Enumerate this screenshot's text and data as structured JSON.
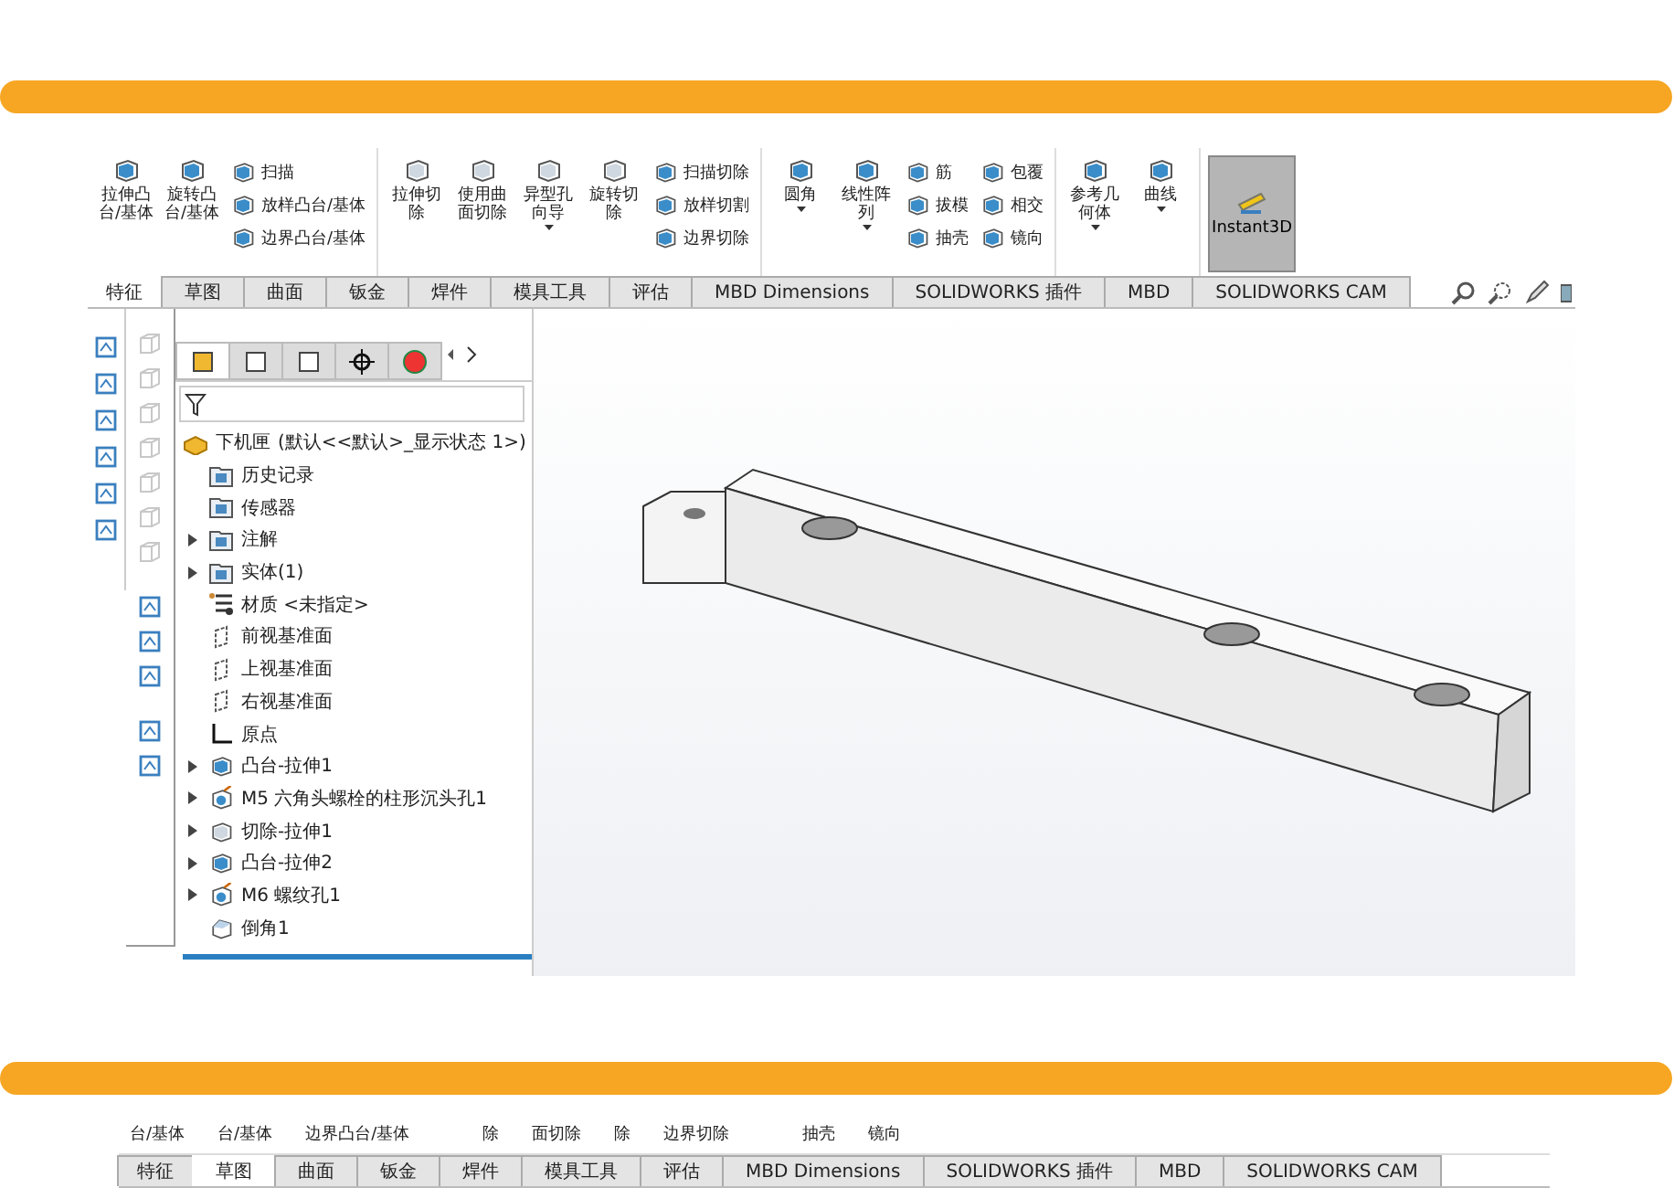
{
  "ribbon": {
    "groups": [
      {
        "big": [
          {
            "label": "拉伸凸台/基体",
            "dropdown": false
          },
          {
            "label": "旋转凸台/基体",
            "dropdown": false
          }
        ],
        "stacks": [
          [
            "扫描",
            "放样凸台/基体",
            "边界凸台/基体"
          ]
        ]
      },
      {
        "big": [
          {
            "label": "拉伸切除",
            "dropdown": false
          },
          {
            "label": "使用曲面切除",
            "dropdown": false
          },
          {
            "label": "异型孔向导",
            "dropdown": true
          },
          {
            "label": "旋转切除",
            "dropdown": false
          }
        ],
        "stacks": [
          [
            "扫描切除",
            "放样切割",
            "边界切除"
          ]
        ]
      },
      {
        "big": [
          {
            "label": "圆角",
            "dropdown": true
          },
          {
            "label": "线性阵列",
            "dropdown": true
          }
        ],
        "stacks": [
          [
            "筋",
            "拔模",
            "抽壳"
          ],
          [
            "包覆",
            "相交",
            "镜向"
          ]
        ]
      },
      {
        "big": [
          {
            "label": "参考几何体",
            "dropdown": true
          },
          {
            "label": "曲线",
            "dropdown": true
          }
        ]
      }
    ],
    "instant3d": {
      "label": "Instant3D",
      "active": true
    }
  },
  "tabs": [
    {
      "label": "特征",
      "selected": true
    },
    {
      "label": "草图",
      "selected": false
    },
    {
      "label": "曲面",
      "selected": false
    },
    {
      "label": "钣金",
      "selected": false
    },
    {
      "label": "焊件",
      "selected": false
    },
    {
      "label": "模具工具",
      "selected": false
    },
    {
      "label": "评估",
      "selected": false
    },
    {
      "label": "MBD Dimensions",
      "selected": false
    },
    {
      "label": "SOLIDWORKS 插件",
      "selected": false
    },
    {
      "label": "MBD",
      "selected": false
    },
    {
      "label": "SOLIDWORKS CAM",
      "selected": false
    }
  ],
  "panel_tabs": [
    {
      "selected": true
    },
    {
      "selected": false
    },
    {
      "selected": false
    },
    {
      "selected": false
    },
    {
      "selected": false
    }
  ],
  "tree": {
    "root": {
      "name": "下机匣",
      "config": "(默认<<默认>_显示状态 1>)"
    },
    "items": [
      {
        "label": "历史记录",
        "kind": "folder",
        "expandable": false
      },
      {
        "label": "传感器",
        "kind": "folder",
        "expandable": false
      },
      {
        "label": "注解",
        "kind": "folder",
        "expandable": true
      },
      {
        "label": "实体(1)",
        "kind": "folder",
        "expandable": true
      },
      {
        "label": "材质 <未指定>",
        "kind": "material",
        "expandable": false
      },
      {
        "label": "前视基准面",
        "kind": "plane",
        "expandable": false
      },
      {
        "label": "上视基准面",
        "kind": "plane",
        "expandable": false
      },
      {
        "label": "右视基准面",
        "kind": "plane",
        "expandable": false
      },
      {
        "label": "原点",
        "kind": "origin",
        "expandable": false
      },
      {
        "label": "凸台-拉伸1",
        "kind": "boss",
        "expandable": true
      },
      {
        "label": "M5 六角头螺栓的柱形沉头孔1",
        "kind": "hole",
        "expandable": true
      },
      {
        "label": "切除-拉伸1",
        "kind": "cut",
        "expandable": true
      },
      {
        "label": "凸台-拉伸2",
        "kind": "boss",
        "expandable": true
      },
      {
        "label": "M6 螺纹孔1",
        "kind": "hole",
        "expandable": true
      },
      {
        "label": "倒角1",
        "kind": "chamfer",
        "expandable": false
      }
    ]
  },
  "lower_ribbon": {
    "labels": [
      "台/基体",
      "台/基体",
      "边界凸台/基体",
      "除",
      "面切除",
      "除",
      "边界切除",
      "抽壳",
      "镜向"
    ],
    "tabs": [
      {
        "label": "特征",
        "selected": false
      },
      {
        "label": "草图",
        "selected": true
      },
      {
        "label": "曲面",
        "selected": false
      },
      {
        "label": "钣金",
        "selected": false
      },
      {
        "label": "焊件",
        "selected": false
      },
      {
        "label": "模具工具",
        "selected": false
      },
      {
        "label": "评估",
        "selected": false
      },
      {
        "label": "MBD Dimensions",
        "selected": false
      },
      {
        "label": "SOLIDWORKS 插件",
        "selected": false
      },
      {
        "label": "MBD",
        "selected": false
      },
      {
        "label": "SOLIDWORKS CAM",
        "selected": false
      }
    ]
  }
}
